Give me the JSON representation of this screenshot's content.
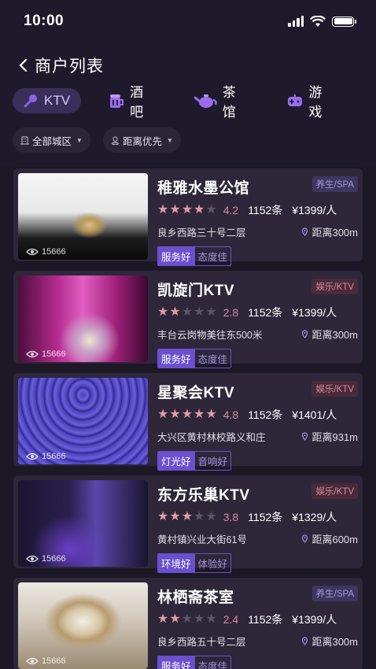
{
  "status_bar": {
    "time": "10:00"
  },
  "header": {
    "title": "商户列表"
  },
  "tabs": [
    {
      "label": "KTV",
      "icon": "microphone-icon",
      "active": true
    },
    {
      "label": "酒吧",
      "icon": "beer-icon",
      "active": false
    },
    {
      "label": "茶馆",
      "icon": "teapot-icon",
      "active": false
    },
    {
      "label": "游戏",
      "icon": "gamepad-icon",
      "active": false
    }
  ],
  "filters": [
    {
      "label": "全部城区",
      "icon": "building-icon"
    },
    {
      "label": "距离优先",
      "icon": "location-icon"
    }
  ],
  "merchants": [
    {
      "name": "稚雅水墨公馆",
      "category": "养生/SPA",
      "cat_type": "spa",
      "stars": 4,
      "score": "4.2",
      "count": "1152条",
      "price": "¥1399/人",
      "address": "良乡西路三十号二层",
      "distance": "距离300m",
      "tags": [
        "服务好",
        "态度佳"
      ],
      "views": "15666",
      "image": "tea-pour"
    },
    {
      "name": "凯旋门KTV",
      "category": "娱乐/KTV",
      "cat_type": "ktv",
      "stars": 2,
      "score": "2.8",
      "count": "1152条",
      "price": "¥1399/人",
      "address": "丰台云岗物美往东500米",
      "distance": "距离300m",
      "tags": [
        "服务好",
        "态度佳"
      ],
      "views": "15666",
      "image": "ktv-pink"
    },
    {
      "name": "星聚会KTV",
      "category": "娱乐/KTV",
      "cat_type": "ktv",
      "stars": 5,
      "score": "4.8",
      "count": "1152条",
      "price": "¥1401/人",
      "address": "大兴区黄村林校路义和庄",
      "distance": "距离931m",
      "tags": [
        "灯光好",
        "音响好"
      ],
      "views": "15666",
      "image": "ktv-blue"
    },
    {
      "name": "东方乐巢KTV",
      "category": "娱乐/KTV",
      "cat_type": "ktv",
      "stars": 3,
      "score": "3.8",
      "count": "1152条",
      "price": "¥1329/人",
      "address": "黄村镇兴业大街61号",
      "distance": "距离600m",
      "tags": [
        "环境好",
        "体验好"
      ],
      "views": "15666",
      "image": "ktv-dark"
    },
    {
      "name": "林栖斋茶室",
      "category": "养生/SPA",
      "cat_type": "spa",
      "stars": 2,
      "score": "2.4",
      "count": "1152条",
      "price": "¥1399/人",
      "address": "良乡西路五十号二层",
      "distance": "距离300m",
      "tags": [
        "服务好",
        "态度佳"
      ],
      "views": "15666",
      "image": "tea-cup"
    }
  ],
  "colors": {
    "accent": "#6a4fcf",
    "background": "#1c1826",
    "card": "#2d2739",
    "rating": "#e39aa6"
  }
}
